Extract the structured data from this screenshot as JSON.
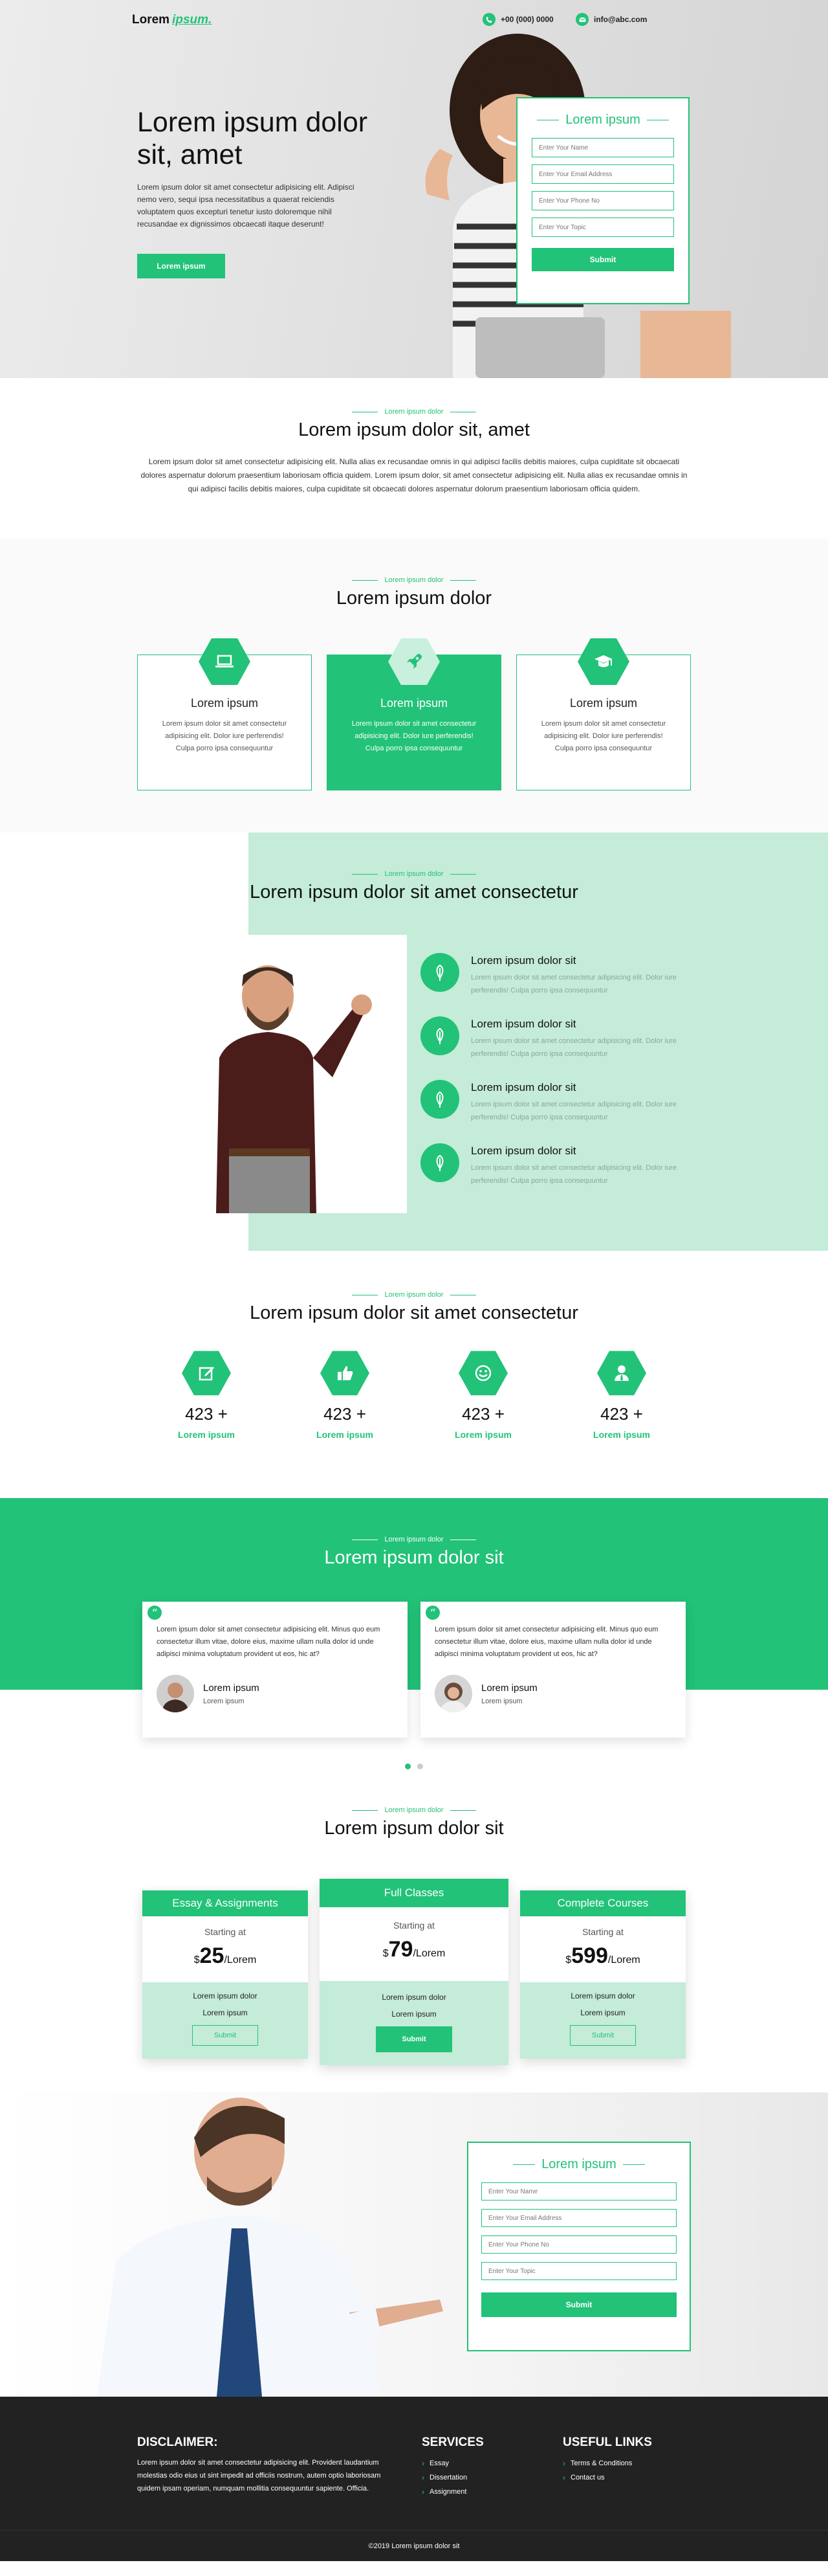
{
  "header": {
    "logo_main": "Lorem",
    "logo_accent": "ipsum.",
    "phone": "+00 (000) 0000",
    "email": "info@abc.com"
  },
  "hero": {
    "title": "Lorem ipsum dolor sit, amet",
    "text": "Lorem ipsum dolor sit amet consectetur adipisicing elit. Adipisci nemo vero, sequi ipsa necessitatibus a quaerat reiciendis voluptatem quos excepturi tenetur iusto doloremque nihil recusandae ex dignissimos obcaecati itaque deserunt!",
    "button": "Lorem ipsum"
  },
  "hero_form": {
    "title": "Lorem ipsum",
    "name_placeholder": "Enter Your Name",
    "email_placeholder": "Enter Your Email Address",
    "phone_placeholder": "Enter Your Phone No",
    "topic_placeholder": "Enter Your Topic",
    "submit": "Submit"
  },
  "intro": {
    "eyebrow": "Lorem ipsum dolor",
    "title": "Lorem ipsum dolor sit, amet",
    "text": "Lorem ipsum dolor sit amet consectetur adipisicing elit. Nulla alias ex recusandae omnis in qui adipisci facilis debitis maiores, culpa cupiditate sit obcaecati dolores aspernatur dolorum praesentium laboriosam officia quidem. Lorem ipsum dolor, sit amet consectetur adipisicing elit. Nulla alias ex recusandae omnis in qui adipisci facilis debitis maiores, culpa cupiditate sit obcaecati dolores aspernatur dolorum praesentium laboriosam officia quidem."
  },
  "services": {
    "eyebrow": "Lorem ipsum dolor",
    "title": "Lorem ipsum dolor",
    "cards": [
      {
        "icon": "laptop-icon",
        "title": "Lorem ipsum",
        "text": "Lorem ipsum dolor sit amet consectetur adipisicing elit. Dolor iure perferendis! Culpa porro ipsa consequuntur"
      },
      {
        "icon": "rocket-icon",
        "title": "Lorem ipsum",
        "text": "Lorem ipsum dolor sit amet consectetur adipisicing elit. Dolor iure perferendis! Culpa porro ipsa consequuntur"
      },
      {
        "icon": "graduation-cap-icon",
        "title": "Lorem ipsum",
        "text": "Lorem ipsum dolor sit amet consectetur adipisicing elit. Dolor iure perferendis! Culpa porro ipsa consequuntur"
      }
    ]
  },
  "features": {
    "eyebrow": "Lorem ipsum dolor",
    "title": "Lorem ipsum dolor sit amet consectetur",
    "items": [
      {
        "title": "Lorem ipsum dolor sit",
        "text": "Lorem ipsum dolor sit amet consectetur adipisicing elit. Dolor iure perferendis! Culpa porro ipsa consequuntur"
      },
      {
        "title": "Lorem ipsum dolor sit",
        "text": "Lorem ipsum dolor sit amet consectetur adipisicing elit. Dolor iure perferendis! Culpa porro ipsa consequuntur"
      },
      {
        "title": "Lorem ipsum dolor sit",
        "text": "Lorem ipsum dolor sit amet consectetur adipisicing elit. Dolor iure perferendis! Culpa porro ipsa consequuntur"
      },
      {
        "title": "Lorem ipsum dolor sit",
        "text": "Lorem ipsum dolor sit amet consectetur adipisicing elit. Dolor iure perferendis! Culpa porro ipsa consequuntur"
      }
    ]
  },
  "stats": {
    "eyebrow": "Lorem ipsum dolor",
    "title": "Lorem ipsum dolor sit amet consectetur",
    "items": [
      {
        "icon": "edit-icon",
        "value": "423 +",
        "label": "Lorem ipsum"
      },
      {
        "icon": "thumbs-up-icon",
        "value": "423 +",
        "label": "Lorem ipsum"
      },
      {
        "icon": "smile-icon",
        "value": "423 +",
        "label": "Lorem ipsum"
      },
      {
        "icon": "user-tie-icon",
        "value": "423 +",
        "label": "Lorem ipsum"
      }
    ]
  },
  "testimonials": {
    "eyebrow": "Lorem ipsum dolor",
    "title": "Lorem ipsum dolor sit",
    "items": [
      {
        "text": "Lorem ipsum dolor sit amet consectetur adipisicing elit. Minus quo eum consectetur illum vitae, dolore eius, maxime ullam nulla dolor id unde adipisci minima voluptatum provident ut eos, hic at?",
        "name": "Lorem ipsum",
        "role": "Lorem ipsum"
      },
      {
        "text": "Lorem ipsum dolor sit amet consectetur adipisicing elit. Minus quo eum consectetur illum vitae, dolore eius, maxime ullam nulla dolor id unde adipisci minima voluptatum provident ut eos, hic at?",
        "name": "Lorem ipsum",
        "role": "Lorem ipsum"
      }
    ]
  },
  "pricing": {
    "eyebrow": "Lorem ipsum dolor",
    "title": "Lorem ipsum dolor sit",
    "plans": [
      {
        "name": "Essay & Assignments",
        "starting": "Starting at",
        "currency": "$",
        "price": "25",
        "unit": "/Lorem",
        "f1": "Lorem ipsum dolor",
        "f2": "Lorem ipsum",
        "button": "Submit"
      },
      {
        "name": "Full Classes",
        "starting": "Starting at",
        "currency": "$",
        "price": "79",
        "unit": "/Lorem",
        "f1": "Lorem ipsum dolor",
        "f2": "Lorem ipsum",
        "button": "Submit"
      },
      {
        "name": "Complete Courses",
        "starting": "Starting at",
        "currency": "$",
        "price": "599",
        "unit": "/Lorem",
        "f1": "Lorem ipsum dolor",
        "f2": "Lorem ipsum",
        "button": "Submit"
      }
    ]
  },
  "cta_form": {
    "title": "Lorem ipsum",
    "name_placeholder": "Enter Your Name",
    "email_placeholder": "Enter Your Email Address",
    "phone_placeholder": "Enter Your Phone No",
    "topic_placeholder": "Enter Your Topic",
    "submit": "Submit"
  },
  "footer": {
    "disclaimer_title": "DISCLAIMER:",
    "disclaimer_text": "Lorem ipsum dolor sit amet consectetur adipisicing elit. Provident laudantium molestias odio eius ut sint impedit ad officiis nostrum, autem optio laboriosam quidem ipsam operiam, numquam mollitia consequuntur sapiente. Officia.",
    "services_title": "SERVICES",
    "services": [
      "Essay",
      "Dissertation",
      "Assignment"
    ],
    "links_title": "USEFUL LINKS",
    "links": [
      "Terms & Conditions",
      "Contact us"
    ],
    "copyright": "©2019 Lorem ipsum dolor sit"
  },
  "colors": {
    "accent": "#22c278",
    "accent_light": "#c4ecd8",
    "footer_bg": "#222222"
  }
}
